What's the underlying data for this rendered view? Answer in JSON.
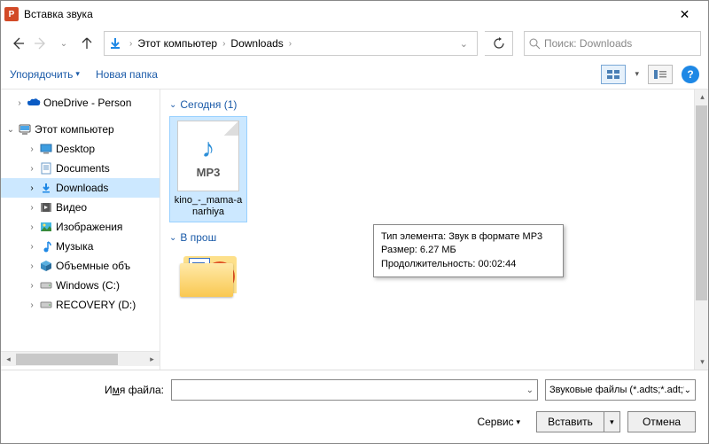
{
  "titlebar": {
    "title": "Вставка звука",
    "app_letter": "P"
  },
  "nav": {
    "breadcrumb_root": "Этот компьютер",
    "breadcrumb_folder": "Downloads",
    "search_placeholder": "Поиск: Downloads"
  },
  "toolbar": {
    "organize": "Упорядочить",
    "new_folder": "Новая папка"
  },
  "sidebar": {
    "onedrive": "OneDrive - Person",
    "this_pc": "Этот компьютер",
    "items": [
      {
        "label": "Desktop"
      },
      {
        "label": "Documents"
      },
      {
        "label": "Downloads"
      },
      {
        "label": "Видео"
      },
      {
        "label": "Изображения"
      },
      {
        "label": "Музыка"
      },
      {
        "label": "Объемные объ"
      },
      {
        "label": "Windows (C:)"
      },
      {
        "label": "RECOVERY (D:)"
      }
    ]
  },
  "content": {
    "group_today": "Сегодня (1)",
    "group_past": "В прош",
    "file": {
      "name": "kino_-_mama-anarhiya"
    },
    "tooltip": {
      "line1": "Тип элемента: Звук в формате MP3",
      "line2": "Размер: 6.27 МБ",
      "line3": "Продолжительность: 00:02:44"
    }
  },
  "footer": {
    "filename_label_pre": "И",
    "filename_label_u": "м",
    "filename_label_post": "я файла:",
    "type_filter": "Звуковые файлы (*.adts;*.adt;*.",
    "service": "Сервис",
    "insert": "Вставить",
    "cancel": "Отмена"
  }
}
